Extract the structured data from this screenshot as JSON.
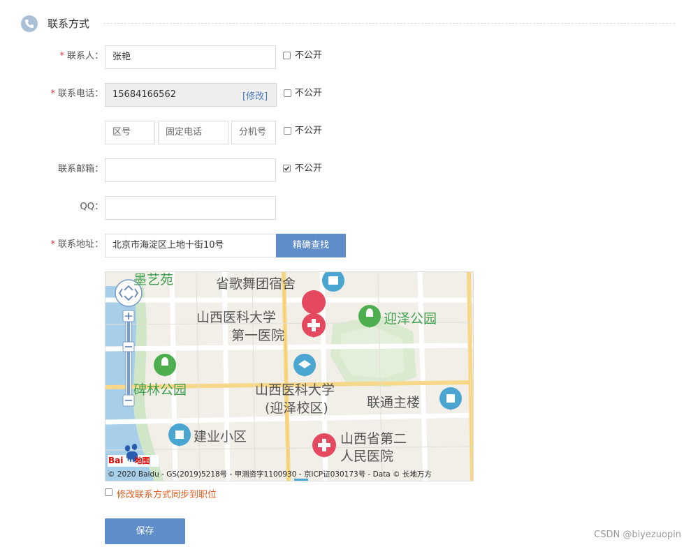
{
  "section": {
    "title": "联系方式",
    "icon": "phone-icon"
  },
  "form": {
    "contact_person": {
      "label": "联系人：",
      "value": "张艳",
      "private_label": "不公开",
      "private_checked": false
    },
    "phone": {
      "label": "联系电话：",
      "value": "15684166562",
      "modify_link": "[修改]",
      "private_label": "不公开",
      "private_checked": false
    },
    "landline": {
      "area_placeholder": "区号",
      "number_placeholder": "固定电话",
      "ext_placeholder": "分机号",
      "private_label": "不公开",
      "private_checked": false
    },
    "email": {
      "label": "联系邮箱：",
      "value": "",
      "private_label": "不公开",
      "private_checked": true
    },
    "qq": {
      "label": "QQ：",
      "value": ""
    },
    "address": {
      "label": "联系地址：",
      "value": "北京市海淀区上地十街10号",
      "search_button": "精确查找"
    },
    "required_mark": "*"
  },
  "map": {
    "labels": {
      "l1": "墨艺苑",
      "l2": "省歌舞团宿舍",
      "l3": "山西医科大学",
      "l4": "第一医院",
      "l5": "迎泽公园",
      "l6": "碑林公园",
      "l7": "山西医科大学",
      "l8": "(迎泽校区)",
      "l9": "联通主楼",
      "l10": "建业小区",
      "l11": "山西省第二",
      "l12": "人民医院"
    },
    "logo_text_bai": "Bai",
    "logo_text_du": "du",
    "logo_text_map": "地图",
    "copyright": "© 2020 Baidu - GS(2019)5218号 - 甲测资字1100930 - 京ICP证030173号 - Data © 长地万方"
  },
  "sync": {
    "label": "修改联系方式同步到职位",
    "checked": false
  },
  "save_button": "保存",
  "watermark": "CSDN @biyezuopin",
  "colors": {
    "accent": "#5e8dc9",
    "required": "#e4393c",
    "sync_text": "#e35b1e",
    "map_park": "#3f9f4c",
    "map_hospital": "#e5495f",
    "map_poi": "#4aa6d1"
  }
}
